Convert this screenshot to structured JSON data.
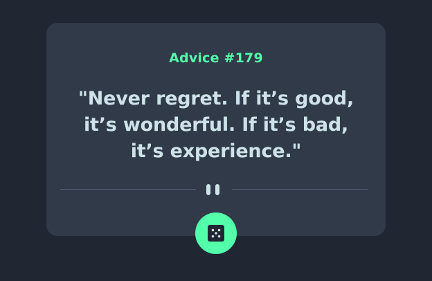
{
  "advice": {
    "id_label": "Advice #179",
    "quote": "\"Never regret. If it’s good, it’s wonderful. If it’s bad, it’s experience.\""
  },
  "icons": {
    "divider": "pause-icon",
    "button": "dice-icon"
  },
  "colors": {
    "background": "#202733",
    "card": "#313a48",
    "accent": "#53ffaa",
    "text": "#cee3e9",
    "divider": "#4f5d74"
  }
}
